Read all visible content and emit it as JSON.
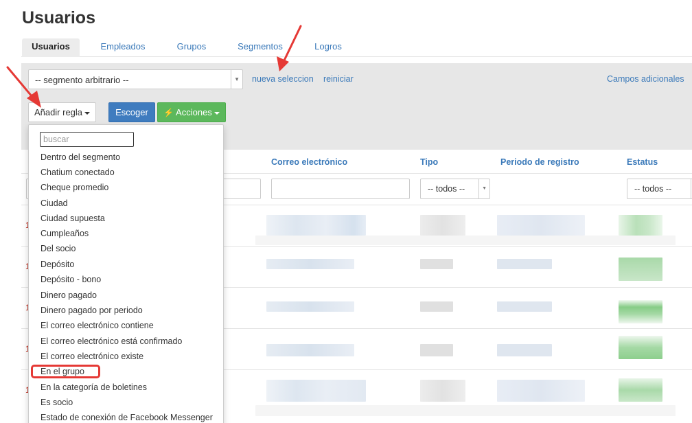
{
  "page": {
    "title": "Usuarios"
  },
  "tabs": [
    {
      "label": "Usuarios",
      "active": true
    },
    {
      "label": "Empleados",
      "active": false
    },
    {
      "label": "Grupos",
      "active": false
    },
    {
      "label": "Segmentos",
      "active": false
    },
    {
      "label": "Logros",
      "active": false
    }
  ],
  "toolbar": {
    "segment_value": "-- segmento arbitrario --",
    "new_selection_link": "nueva seleccion",
    "reset_link": "reiniciar",
    "additional_fields_link": "Campos adicionales",
    "add_rule_button": "Añadir regla",
    "choose_button": "Escoger",
    "actions_button": "Acciones"
  },
  "table": {
    "headers": [
      "Correo electrónico",
      "Tipo",
      "Periodo de registro",
      "Estatus"
    ],
    "filters": {
      "tipo_value": "-- todos --",
      "estatus_value": "-- todos --"
    },
    "row_marks": [
      "1",
      "1",
      "1",
      "1",
      "1"
    ]
  },
  "dropdown": {
    "search_placeholder": "buscar",
    "items": [
      "Dentro del segmento",
      "Chatium conectado",
      "Cheque promedio",
      "Ciudad",
      "Ciudad supuesta",
      "Cumpleaños",
      "Del socio",
      "Depósito",
      "Depósito - bono",
      "Dinero pagado",
      "Dinero pagado por periodo",
      "El correo electrónico contiene",
      "El correo electrónico está confirmado",
      "El correo electrónico existe",
      "En el grupo",
      "En la categoría de boletines",
      "Es socio",
      "Estado de conexión de Facebook Messenger"
    ],
    "highlighted_item": "En el grupo"
  },
  "colors": {
    "link": "#3a79b9",
    "primary": "#3f7cbf",
    "success": "#5cb85c",
    "annotation": "#e53935",
    "toolbar_bg": "#e7e7e7"
  },
  "icons": {
    "actions": "lightning-bolt-icon",
    "caret": "caret-down-icon",
    "select_arrow": "chevron-down-icon",
    "annotation": "red-arrow-icon"
  }
}
